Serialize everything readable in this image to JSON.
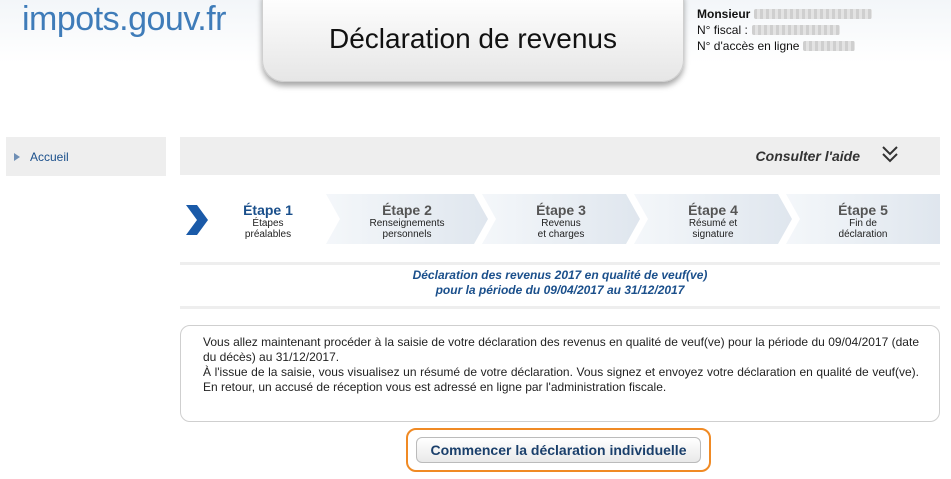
{
  "header": {
    "logo": "impots.gouv.fr",
    "title": "Déclaration de revenus",
    "user": {
      "salutation": "Monsieur",
      "fiscal_label": "N° fiscal :",
      "access_label": "N° d'accès en ligne"
    }
  },
  "sidebar": {
    "items": [
      {
        "label": "Accueil",
        "icon": "arrow-right-icon"
      }
    ]
  },
  "help": {
    "label": "Consulter l'aide",
    "icon": "double-chevron-down-icon"
  },
  "steps": [
    {
      "title": "Étape 1",
      "subtitle_1": "Étapes",
      "subtitle_2": "préalables",
      "active": true
    },
    {
      "title": "Étape 2",
      "subtitle_1": "Renseignements",
      "subtitle_2": "personnels",
      "active": false
    },
    {
      "title": "Étape 3",
      "subtitle_1": "Revenus",
      "subtitle_2": "et charges",
      "active": false
    },
    {
      "title": "Étape 4",
      "subtitle_1": "Résumé et",
      "subtitle_2": "signature",
      "active": false
    },
    {
      "title": "Étape 5",
      "subtitle_1": "Fin de",
      "subtitle_2": "déclaration",
      "active": false
    }
  ],
  "notice": {
    "line1": "Déclaration des revenus 2017 en qualité de veuf(ve)",
    "line2": "pour la période du 09/04/2017 au 31/12/2017"
  },
  "info": {
    "paragraph1": "Vous allez maintenant procéder à la saisie de votre déclaration des revenus en qualité de veuf(ve) pour la période du 09/04/2017 (date du décès) au 31/12/2017.",
    "paragraph2": "À l'issue de la saisie, vous visualisez un résumé de votre déclaration. Vous signez et envoyez votre déclaration en qualité de veuf(ve). En retour, un accusé de réception vous est adressé en ligne par l'administration fiscale."
  },
  "actions": {
    "start_label": "Commencer la déclaration individuelle"
  },
  "colors": {
    "brand_blue": "#3f7cb9",
    "accent_orange": "#f08a24",
    "step_active": "#1a4f8b",
    "step_inactive": "#dfe6ee"
  }
}
